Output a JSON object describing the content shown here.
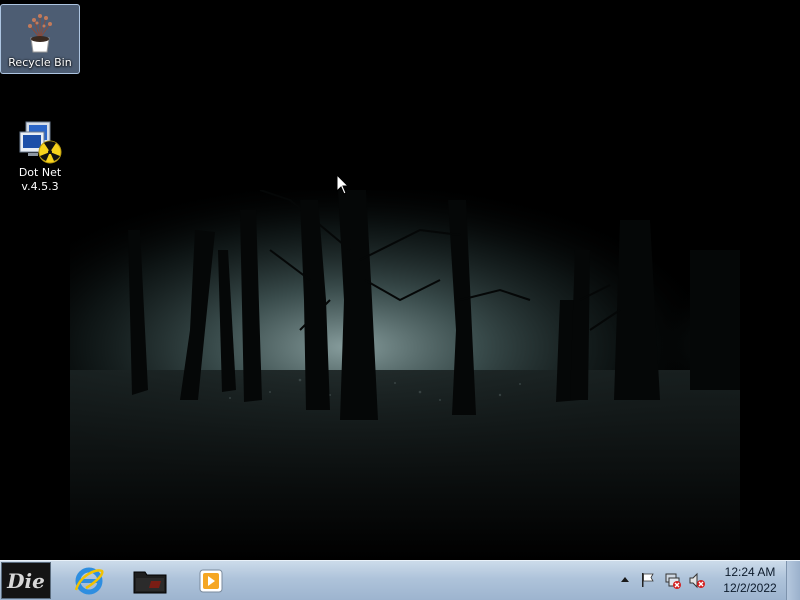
{
  "desktop": {
    "icons": [
      {
        "label_lines": [
          "Recycle Bin"
        ],
        "icon": "recycle-bin-icon",
        "selected": true
      },
      {
        "label_lines": [
          "Dot Net",
          "v.4.5.3"
        ],
        "icon": "dotnet-installer-icon",
        "selected": false
      }
    ],
    "wallpaper": "dark-misty-forest"
  },
  "taskbar": {
    "start_button": {
      "text": "Die",
      "icon": "start-orb-icon"
    },
    "pinned": [
      {
        "name": "internet-explorer",
        "icon": "ie-icon"
      },
      {
        "name": "folder",
        "icon": "folder-icon"
      },
      {
        "name": "media-player",
        "icon": "media-player-icon"
      }
    ],
    "tray": {
      "icons": [
        "show-hidden-icons-arrow-icon",
        "action-center-flag-icon",
        "network-disconnected-icon",
        "volume-muted-icon"
      ],
      "time": "12:24 AM",
      "date": "12/2/2022"
    }
  },
  "colors": {
    "taskbar_top": "#ccdbea",
    "taskbar_bottom": "#9db4cf",
    "selection": "#8caad2"
  }
}
